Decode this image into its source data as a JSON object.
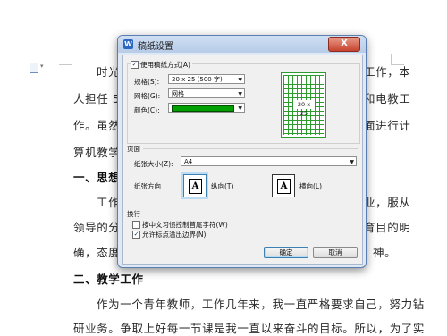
{
  "document": {
    "lines": [
      {
        "text": "时光",
        "cls": ""
      },
      {
        "text": "工作，本",
        "cls": ""
      },
      {
        "text": "人担任 5",
        "cls": ""
      },
      {
        "text": "和电教工",
        "cls": ""
      },
      {
        "text": "作。虽然",
        "cls": ""
      },
      {
        "text": "面进行计",
        "cls": ""
      },
      {
        "text": "算机教学",
        "cls": ""
      },
      {
        "text": "：",
        "cls": ""
      },
      {
        "text": "一、思想",
        "cls": "bold"
      },
      {
        "text": "工作",
        "cls": ""
      },
      {
        "text": "业，服从",
        "cls": ""
      },
      {
        "text": "领导的分",
        "cls": ""
      },
      {
        "text": "育目的明",
        "cls": ""
      },
      {
        "text": "确，态度",
        "cls": ""
      },
      {
        "text": "神。",
        "cls": ""
      },
      {
        "text": "二、教学工作",
        "cls": "bold"
      },
      {
        "text": "作为一个青年教师，工作几年来，我一直严格要求自己，努力钻",
        "cls": ""
      },
      {
        "text": "研业务。争取上好每一节课是我一直以来奋斗的目标。所以，为了实",
        "cls": ""
      }
    ]
  },
  "dialog": {
    "title": "稿纸设置",
    "close_label": "X",
    "use_grid": {
      "label": "使用稿纸方式(A)",
      "checked": true
    },
    "spec": {
      "label": "规格(S):",
      "value": "20 x 25 (500 字)"
    },
    "grid": {
      "label": "网格(G):",
      "value": "网格"
    },
    "color": {
      "label": "颜色(C):",
      "value": "#00a000"
    },
    "preview_label": "20 x 25",
    "page_section": "页面",
    "paper_size": {
      "label": "纸张大小(Z):",
      "value": "A4"
    },
    "orientation": {
      "label": "纸张方向",
      "portrait": "纵向(T)",
      "landscape": "横向(L)",
      "selected": "portrait",
      "glyph": "A"
    },
    "wrap_section": "换行",
    "options": [
      {
        "label": "按中文习惯控制首尾字符(W)",
        "checked": false
      },
      {
        "label": "允许标点溢出边界(N)",
        "checked": true
      }
    ],
    "ok_label": "确定",
    "cancel_label": "取消"
  }
}
